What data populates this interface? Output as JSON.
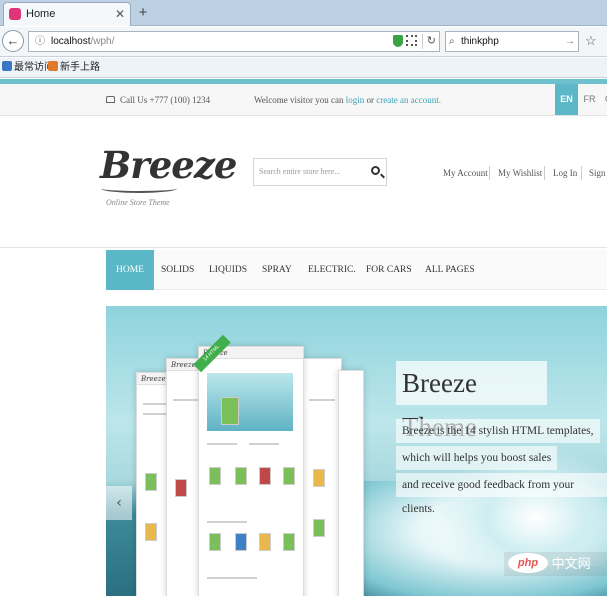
{
  "browser": {
    "tab_title": "Home",
    "url_host": "localhost",
    "url_path": "/wph/",
    "search_value": "thinkphp",
    "bookmarks": [
      "最常访问",
      "新手上路"
    ]
  },
  "topbar": {
    "phone": "Call Us +777 (100) 1234",
    "welcome_prefix": "Welcome visitor you can",
    "login_link": "login",
    "or_text": "or",
    "create_link": "create an account.",
    "languages": [
      "EN",
      "FR",
      "GE"
    ]
  },
  "header": {
    "logo": "Breeze",
    "tagline": "Online Store Theme",
    "search_placeholder": "Search entire store here...",
    "account_links": [
      "My Account",
      "My Wishlist",
      "Log In",
      "Sign"
    ]
  },
  "nav": {
    "items": [
      "HOME",
      "SOLIDS",
      "LIQUIDS",
      "SPRAY",
      "ELECTRIC.",
      "FOR CARS",
      "ALL PAGES"
    ]
  },
  "hero": {
    "title": "Breeze Theme",
    "lines": [
      "Breeze is the 14 stylish HTML templates,",
      "which will helps you boost sales",
      "and receive good feedback from your clients."
    ],
    "ribbon": "14 HTML"
  },
  "watermark": {
    "logo": "php",
    "text": "中文网"
  },
  "colors": {
    "accent": "#5ab7c6",
    "link": "#3ba3b5"
  }
}
